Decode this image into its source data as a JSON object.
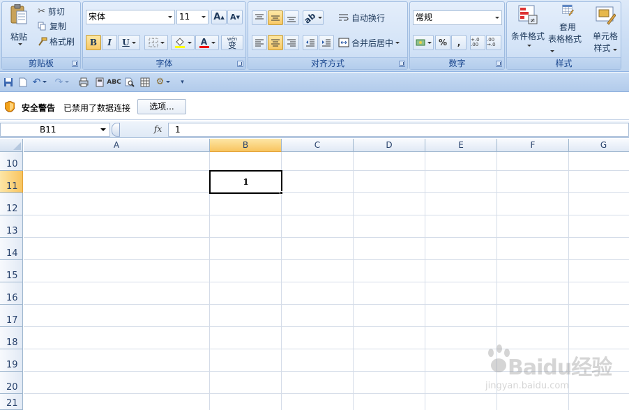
{
  "ribbon": {
    "clipboard": {
      "label": "剪贴板",
      "paste": "粘贴",
      "cut": "剪切",
      "copy": "复制",
      "format_painter": "格式刷"
    },
    "font": {
      "label": "字体",
      "font_name": "宋体",
      "font_size": "11",
      "bold": "B",
      "italic": "I",
      "underline": "U",
      "font_color_glyph": "A",
      "phonetic": "wén",
      "phonetic_char": "变",
      "grow_glyph": "A",
      "shrink_glyph": "A"
    },
    "alignment": {
      "label": "对齐方式",
      "wrap_text": "自动换行",
      "merge_center": "合并后居中"
    },
    "number": {
      "label": "数字",
      "format": "常规",
      "percent": "%",
      "comma": ",",
      "increase_decimal": "+.0 .00",
      "decrease_decimal": ".00 →.0"
    },
    "styles": {
      "label": "样式",
      "conditional_format": "条件格式",
      "table_format_1": "套用",
      "table_format_2": "表格格式",
      "cell_styles_1": "单元格",
      "cell_styles_2": "样式"
    }
  },
  "security_bar": {
    "title": "安全警告",
    "message": "已禁用了数据连接",
    "options_button": "选项..."
  },
  "formula_bar": {
    "name_box": "B11",
    "fx": "fx",
    "value": "1"
  },
  "sheet": {
    "columns": [
      "A",
      "B",
      "C",
      "D",
      "E",
      "F",
      "G"
    ],
    "rows": [
      "10",
      "11",
      "12",
      "13",
      "14",
      "15",
      "16",
      "17",
      "18",
      "19",
      "20",
      "21"
    ],
    "active_cell": "B11",
    "active_value": "1"
  },
  "watermark": {
    "text": "Baidu经验",
    "sub": "jingyan.baidu.com"
  },
  "colors": {
    "accent": "#15428b",
    "selected": "#f8c45f"
  }
}
